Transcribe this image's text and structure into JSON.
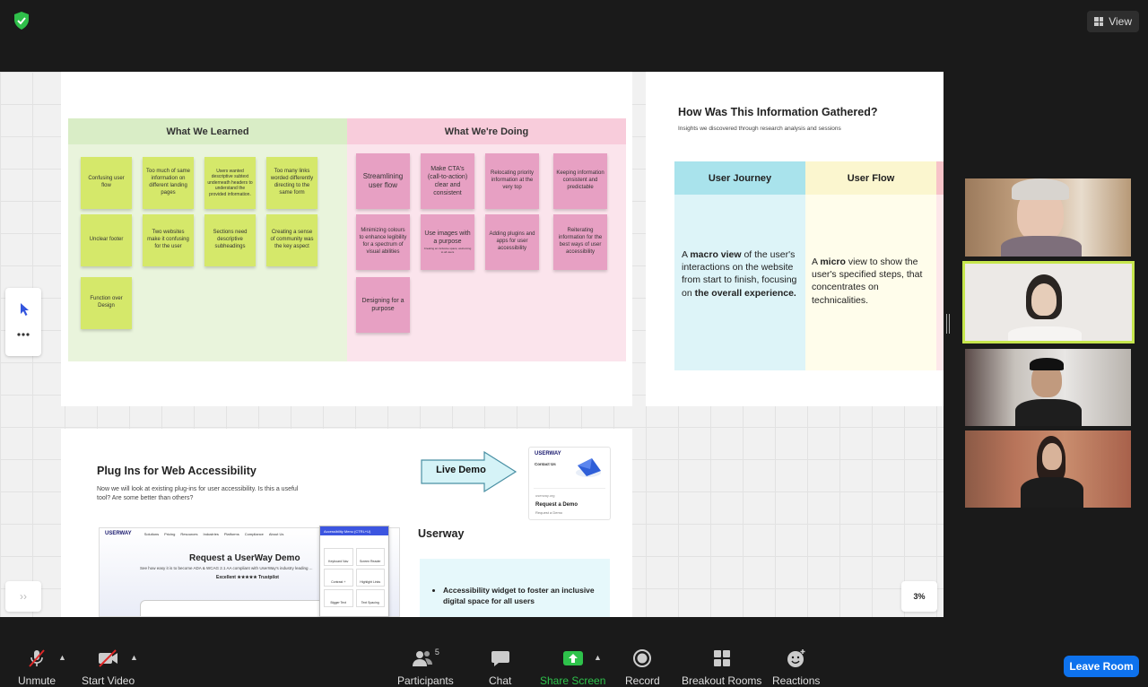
{
  "top_bar": {
    "view_label": "View"
  },
  "board1": {
    "learned_title": "What We Learned",
    "doing_title": "What We're Doing",
    "learned_notes": [
      "Confusing user flow",
      "Too much of same information on different landing pages",
      "Users wanted descriptive subtext underneath headers to understand the provided information.",
      "Too many links worded differently directing to the same form",
      "Unclear footer",
      "Two websites make it confusing for the user",
      "Sections need descriptive subheadings",
      "Creating a sense of community was the key aspect",
      "Function over Design"
    ],
    "doing_notes": [
      "Streamlining user flow",
      "Make CTA's (call-to-action) clear and consistent",
      "Relocating priority information at the very top",
      "Keeping information consistent and predictable",
      "Minimizing colours to enhance legibility for a spectrum of visual abilities",
      "Use images with a purpose",
      "Adding plugins and apps for user accessibility",
      "Reiterating information for the best ways of user accessibility",
      "Designing for a purpose"
    ],
    "doing_small_note": "Creating an inclusive space; welcoming to all users"
  },
  "board2": {
    "title": "How Was This Information Gathered?",
    "subtitle": "Insights we discovered through research analysis and sessions",
    "journey_head": "User Journey",
    "flow_head": "User Flow",
    "journey_a": "A ",
    "journey_b": "macro view",
    "journey_c": " of the user's interactions on the website from start to finish, focusing on ",
    "journey_d": "the overall experience.",
    "flow_a": "A ",
    "flow_b": "micro",
    "flow_c": " view to show the user's specified steps, that concentrates on technicalities."
  },
  "board3": {
    "title": "Plug Ins for Web Accessibility",
    "subtitle": "Now we will look at existing plug-ins for user accessibility. Is this a useful tool? Are some better than others?",
    "arrow_label": "Live Demo",
    "card_logo": "USERWAY",
    "card_contact": "Contact Us",
    "card_domain": "userway.org",
    "card_request": "Request a Demo",
    "card_request_sub": "Request a Demo",
    "site_logo": "USERWAY",
    "site_nav": [
      "Solutions",
      "Pricing",
      "Resources",
      "Industries",
      "Platforms",
      "Compliance",
      "About Us"
    ],
    "site_heading": "Request a UserWay Demo",
    "site_text": "See how easy it is to become ADA & WCAG 2.1 AA compliant with UserWay's industry leading ...",
    "site_excellent": "Excellent ★★★★★ Trustpilot",
    "widget_title": "Accessibility Menu (CTRL+U)",
    "widget_items": [
      "Keyboard Nav",
      "Screen Reader",
      "Contrast +",
      "Highlight Links",
      "Bigger Text",
      "Text Spacing"
    ],
    "userway_title": "Userway",
    "userway_bullet": "Accessibility widget to foster an inclusive digital space for all users"
  },
  "zoom_level": "3%",
  "toolbar": {
    "unmute": "Unmute",
    "start_video": "Start Video",
    "participants": "Participants",
    "participants_count": "5",
    "chat": "Chat",
    "share_screen": "Share Screen",
    "record": "Record",
    "breakout": "Breakout Rooms",
    "reactions": "Reactions",
    "leave": "Leave Room"
  },
  "colors": {
    "accent_green": "#2ec24b",
    "leave_blue": "#0e72ed",
    "active_speaker": "#c6e64d"
  }
}
